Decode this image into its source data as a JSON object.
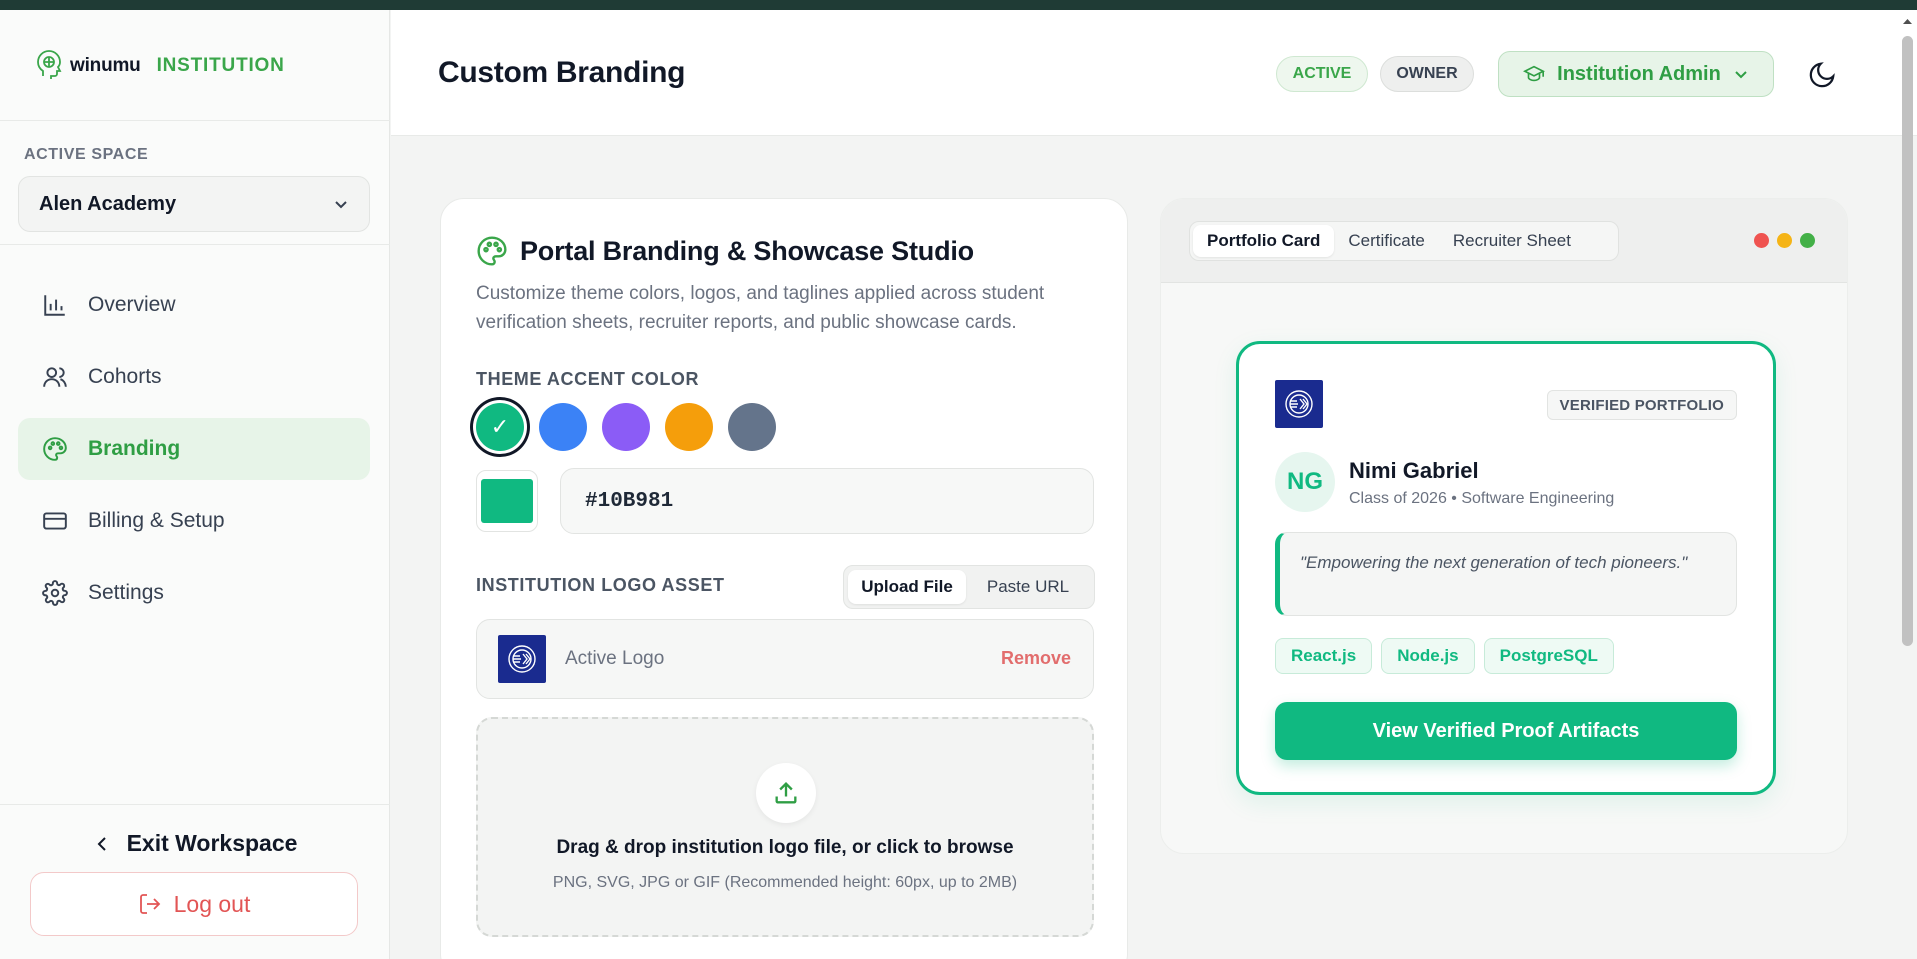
{
  "brand": {
    "name": "winumu",
    "sub": "INSTITUTION"
  },
  "sidebar": {
    "space_label": "ACTIVE SPACE",
    "space_value": "Alen Academy",
    "items": [
      {
        "label": "Overview",
        "icon": "bar-chart-icon"
      },
      {
        "label": "Cohorts",
        "icon": "users-icon"
      },
      {
        "label": "Branding",
        "icon": "palette-icon",
        "active": true
      },
      {
        "label": "Billing & Setup",
        "icon": "credit-card-icon"
      },
      {
        "label": "Settings",
        "icon": "gear-icon"
      }
    ],
    "exit_label": "Exit Workspace",
    "logout_label": "Log out"
  },
  "header": {
    "title": "Custom Branding",
    "status_badge": "ACTIVE",
    "role_badge": "OWNER",
    "role_menu": "Institution Admin"
  },
  "studio": {
    "title": "Portal Branding & Showcase Studio",
    "description": "Customize theme colors, logos, and taglines applied across student verification sheets, recruiter reports, and public showcase cards.",
    "accent_label": "THEME ACCENT COLOR",
    "swatches": [
      "#10B981",
      "#3B82F6",
      "#8B5CF6",
      "#F59E0B",
      "#64748B"
    ],
    "selected_mark": "✓",
    "hex_value": "#10B981",
    "logo_label": "INSTITUTION LOGO ASSET",
    "upload_tab": "Upload File",
    "url_tab": "Paste URL",
    "active_logo_label": "Active Logo",
    "remove_label": "Remove",
    "drop_main": "Drag & drop institution logo file, or click to browse",
    "drop_sub": "PNG, SVG, JPG or GIF (Recommended height: 60px, up to 2MB)"
  },
  "preview": {
    "tabs": [
      "Portfolio Card",
      "Certificate",
      "Recruiter Sheet"
    ],
    "badge": "VERIFIED PORTFOLIO",
    "initials": "NG",
    "name": "Nimi Gabriel",
    "class_line": "Class of 2026 • Software Engineering",
    "quote": "\"Empowering the next generation of tech pioneers.\"",
    "tags": [
      "React.js",
      "Node.js",
      "PostgreSQL"
    ],
    "cta": "View Verified Proof Artifacts"
  },
  "colors": {
    "accent": "#10B981",
    "brand_green": "#3aa64a",
    "danger": "#e25555",
    "logo_bg": "#1a2b8f"
  }
}
